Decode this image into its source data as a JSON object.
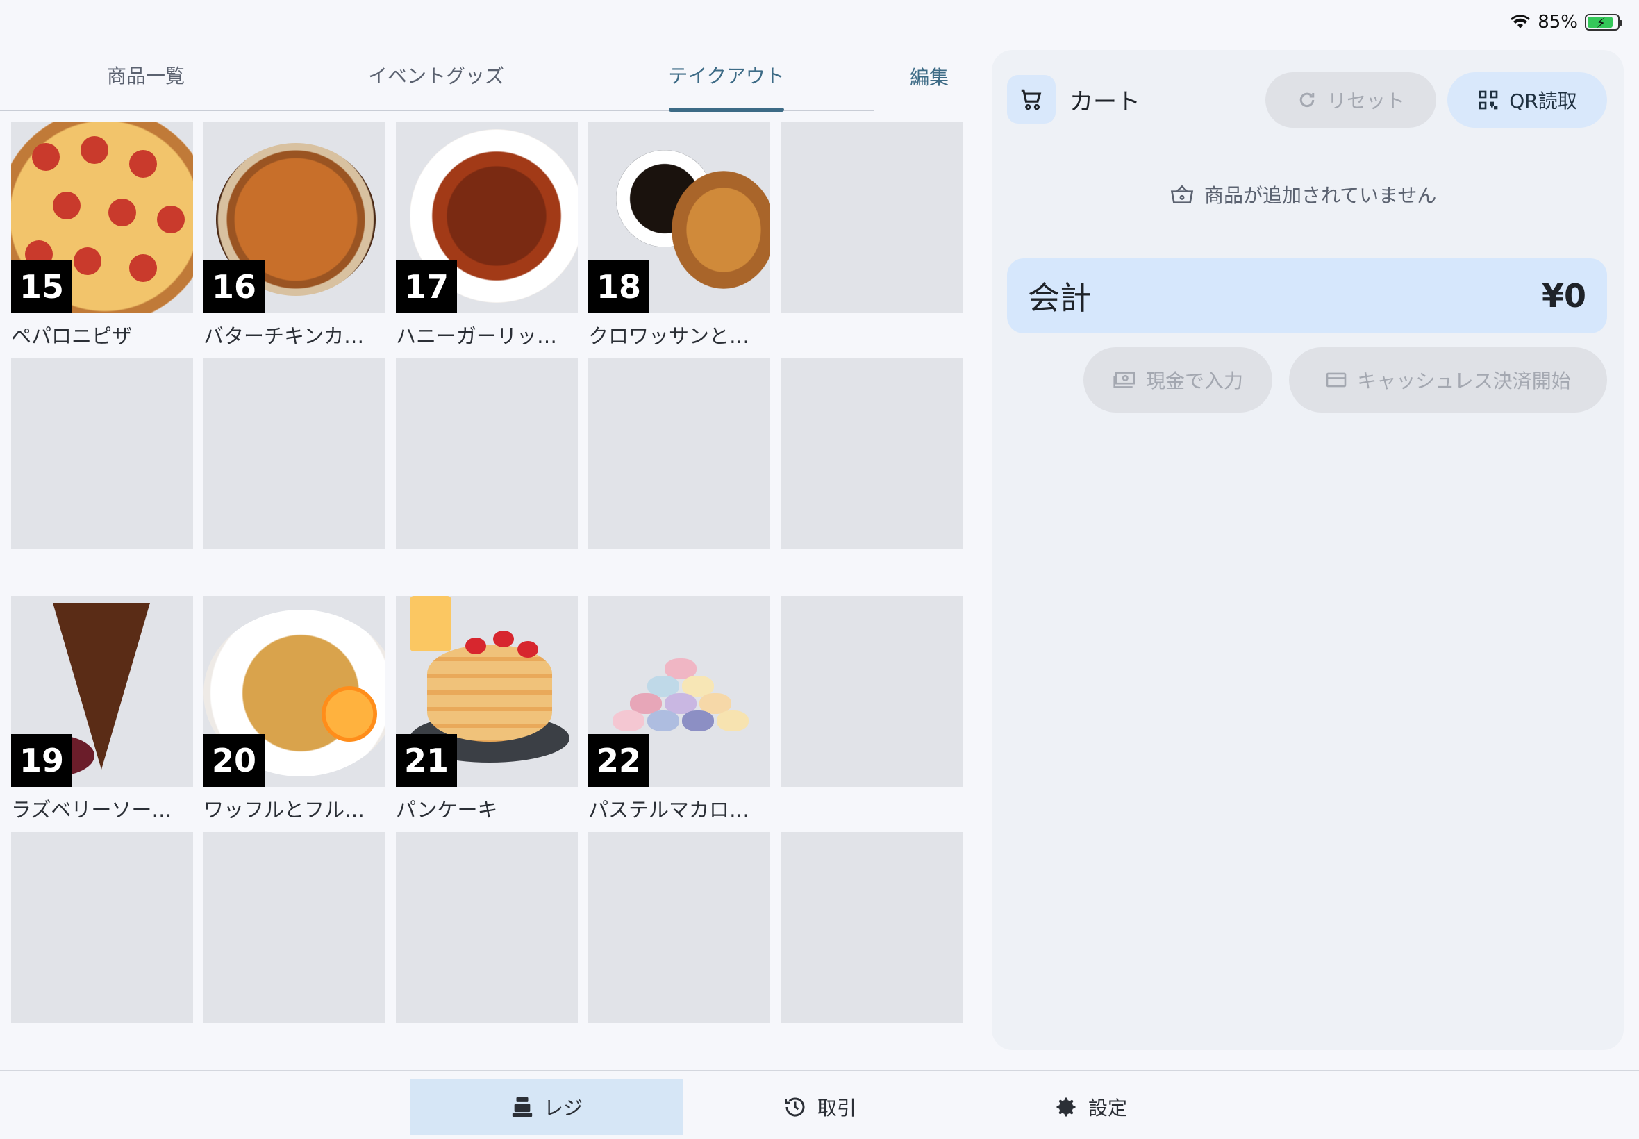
{
  "status": {
    "battery_text": "85%",
    "battery_level": 0.85
  },
  "tabs": [
    {
      "label": "商品一覧",
      "active": false
    },
    {
      "label": "イベントグッズ",
      "active": false
    },
    {
      "label": "テイクアウト",
      "active": true
    }
  ],
  "edit_label": "編集",
  "products": [
    {
      "num": "15",
      "name": "ペパロニピザ",
      "image": "pepperoni-pizza"
    },
    {
      "num": "16",
      "name": "バターチキンカ…",
      "image": "butter-chicken-curry"
    },
    {
      "num": "17",
      "name": "ハニーガーリッ…",
      "image": "honey-garlic-wings"
    },
    {
      "num": "18",
      "name": "クロワッサンと…",
      "image": "croissant-coffee"
    },
    {
      "num": "19",
      "name": "ラズベリーソー…",
      "image": "chocolate-cake"
    },
    {
      "num": "20",
      "name": "ワッフルとフル…",
      "image": "waffle-fruit"
    },
    {
      "num": "21",
      "name": "パンケーキ",
      "image": "pancakes"
    },
    {
      "num": "22",
      "name": "パステルマカロ…",
      "image": "pastel-macarons"
    }
  ],
  "cart": {
    "title": "カート",
    "reset_label": "リセット",
    "qr_label": "QR読取",
    "empty_message": "商品が追加されていません",
    "checkout_label": "会計",
    "total": "¥0",
    "cash_label": "現金で入力",
    "cashless_label": "キャッシュレス決済開始"
  },
  "nav": [
    {
      "label": "レジ",
      "icon": "register-icon",
      "active": true
    },
    {
      "label": "取引",
      "icon": "history-icon",
      "active": false
    },
    {
      "label": "設定",
      "icon": "settings-gear-icon",
      "active": false
    }
  ],
  "colors": {
    "accent": "#3d6b86",
    "checkout_bg": "#d6e7fc",
    "qr_bg": "#d9e8fb",
    "nav_active_bg": "#d6e6f6"
  }
}
